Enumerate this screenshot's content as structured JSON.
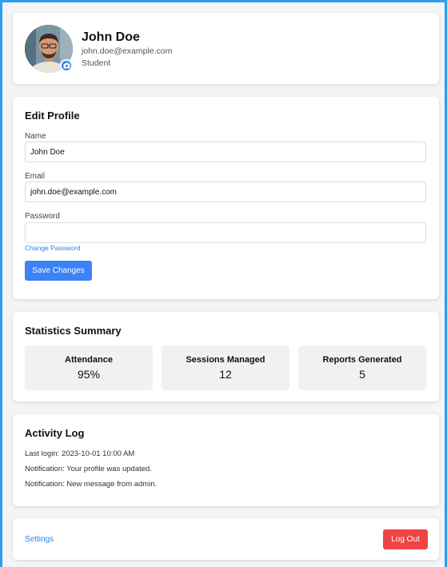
{
  "profile": {
    "name": "John Doe",
    "email": "john.doe@example.com",
    "role": "Student",
    "avatar_icon": "person-avatar",
    "camera_icon": "camera-icon"
  },
  "edit_profile": {
    "title": "Edit Profile",
    "name_label": "Name",
    "name_value": "John Doe",
    "email_label": "Email",
    "email_value": "john.doe@example.com",
    "password_label": "Password",
    "password_value": "",
    "change_password_link": "Change Password",
    "save_button": "Save Changes"
  },
  "statistics": {
    "title": "Statistics Summary",
    "items": [
      {
        "label": "Attendance",
        "value": "95%"
      },
      {
        "label": "Sessions Managed",
        "value": "12"
      },
      {
        "label": "Reports Generated",
        "value": "5"
      }
    ]
  },
  "activity_log": {
    "title": "Activity Log",
    "items": [
      "Last login: 2023-10-01 10:00 AM",
      "Notification: Your profile was updated.",
      "Notification: New message from admin."
    ]
  },
  "footer": {
    "settings_link": "Settings",
    "logout_button": "Log Out"
  },
  "colors": {
    "accent": "#3b82f6",
    "danger": "#ef4444",
    "frame": "#2f9cf0",
    "background": "#f3f4f6"
  }
}
